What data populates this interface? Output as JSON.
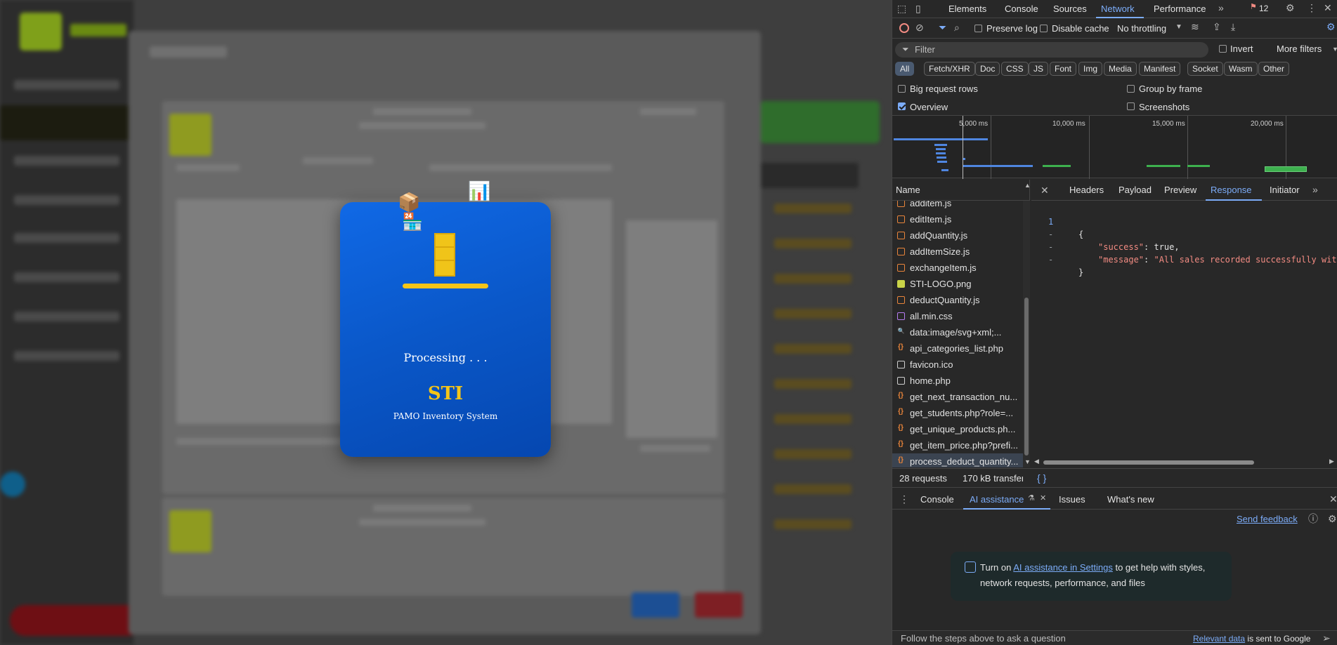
{
  "loader": {
    "processing_text": "Processing . . .",
    "brand": "STI",
    "subtitle": "PAMO Inventory System"
  },
  "devtools": {
    "main_tabs": [
      "Elements",
      "Console",
      "Sources",
      "Network",
      "Performance"
    ],
    "active_main_tab": "Network",
    "issues_badge": "12",
    "toolbar": {
      "preserve_log": "Preserve log",
      "disable_cache": "Disable cache",
      "throttling": "No throttling"
    },
    "filter": {
      "placeholder": "Filter",
      "invert": "Invert",
      "more_filters": "More filters"
    },
    "type_chips": [
      "All",
      "Fetch/XHR",
      "Doc",
      "CSS",
      "JS",
      "Font",
      "Img",
      "Media",
      "Manifest",
      "Socket",
      "Wasm",
      "Other"
    ],
    "options": {
      "big_request_rows": "Big request rows",
      "group_by_frame": "Group by frame",
      "overview": "Overview",
      "screenshots": "Screenshots"
    },
    "overview_ticks": [
      "5,000 ms",
      "10,000 ms",
      "15,000 ms",
      "20,000 ms"
    ],
    "name_header": "Name",
    "requests": [
      {
        "name": "additem.js",
        "type": "js"
      },
      {
        "name": "editItem.js",
        "type": "js"
      },
      {
        "name": "addQuantity.js",
        "type": "js"
      },
      {
        "name": "addItemSize.js",
        "type": "js"
      },
      {
        "name": "exchangeItem.js",
        "type": "js"
      },
      {
        "name": "STI-LOGO.png",
        "type": "img"
      },
      {
        "name": "deductQuantity.js",
        "type": "js"
      },
      {
        "name": "all.min.css",
        "type": "css"
      },
      {
        "name": "data:image/svg+xml;...",
        "type": "data"
      },
      {
        "name": "api_categories_list.php",
        "type": "xhr"
      },
      {
        "name": "favicon.ico",
        "type": "doc"
      },
      {
        "name": "home.php",
        "type": "doc"
      },
      {
        "name": "get_next_transaction_nu...",
        "type": "xhr"
      },
      {
        "name": "get_students.php?role=...",
        "type": "xhr"
      },
      {
        "name": "get_unique_products.ph...",
        "type": "xhr"
      },
      {
        "name": "get_item_price.php?prefi...",
        "type": "xhr"
      },
      {
        "name": "process_deduct_quantity...",
        "type": "xhr"
      }
    ],
    "detail_tabs": [
      "Headers",
      "Payload",
      "Preview",
      "Response",
      "Initiator"
    ],
    "active_detail_tab": "Response",
    "response_lines": [
      {
        "num": "1",
        "text": "{"
      },
      {
        "num": "-",
        "key": "\"success\"",
        "value": "true,"
      },
      {
        "num": "-",
        "key": "\"message\"",
        "value": "\"All sales recorded successfully wit"
      },
      {
        "num": "-",
        "text": "}"
      }
    ],
    "status": {
      "requests": "28 requests",
      "transferred": "170 kB transferre"
    },
    "drawer_tabs": [
      "Console",
      "AI assistance",
      "Issues",
      "What's new"
    ],
    "active_drawer_tab": "AI assistance",
    "send_feedback": "Send feedback",
    "ai_card": {
      "prefix": "Turn on ",
      "link": "AI assistance in Settings",
      "suffix": " to get help with styles, network requests, performance, and files"
    },
    "prompt": {
      "placeholder": "Follow the steps above to ask a question",
      "relevant_data": "Relevant data",
      "sent_to": " is sent to Google"
    }
  }
}
